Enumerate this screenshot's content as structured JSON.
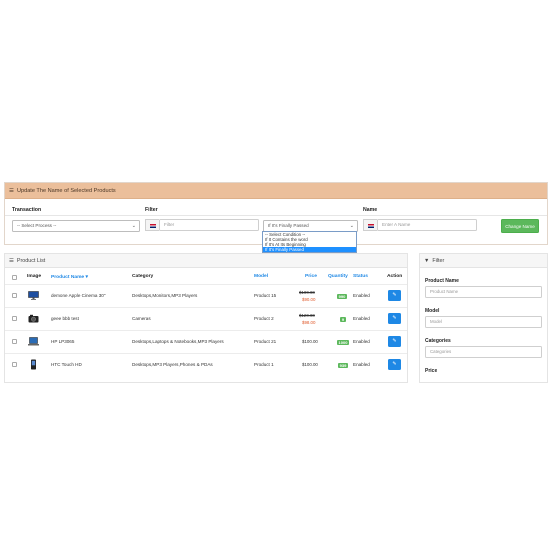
{
  "update_panel": {
    "title": "Update The Name of Selected Products",
    "transaction_label": "Transaction",
    "filter_label": "Filter",
    "name_label": "Name",
    "process_select_value": "-- Select Process --",
    "filter_placeholder": "Filter",
    "condition_select_value": "If It's Finally Passed",
    "condition_options": [
      "-- Select Condition --",
      "If It Contains the word",
      "If It's At Its Beginning",
      "If It's Finally Passed"
    ],
    "condition_selected_index": 3,
    "name_placeholder": "Enter A Name",
    "change_button_label": "Change Name"
  },
  "product_list": {
    "title": "Product List",
    "columns": {
      "image": "Image",
      "product_name": "Product Name",
      "category": "Category",
      "model": "Model",
      "price": "Price",
      "quantity": "Quantity",
      "status": "Status",
      "action": "Action"
    },
    "sort_icon": "caret-down-icon",
    "rows": [
      {
        "image": "monitor-icon",
        "name": "demone Apple Cinema 30\"",
        "category": "Desktops,Monitors,MP3 Players",
        "model": "Product 15",
        "price_old": "$100.00",
        "price_new": "$90.00",
        "quantity": "990",
        "status": "Enabled"
      },
      {
        "image": "camera-icon",
        "name": "geee bbb test",
        "category": "Cameras",
        "model": "Product 2",
        "price_old": "$120.00",
        "price_new": "$98.00",
        "quantity": "9",
        "status": "Enabled"
      },
      {
        "image": "laptop-icon",
        "name": "HP LP3065",
        "category": "Desktops,Laptops & Notebooks,MP3 Players",
        "model": "Product 21",
        "price_old": "",
        "price_new": "",
        "price": "$100.00",
        "quantity": "1000",
        "status": "Enabled"
      },
      {
        "image": "phone-icon",
        "name": "HTC Touch HD",
        "category": "Desktops,MP3 Players,Phones & PDAs",
        "model": "Product 1",
        "price_old": "",
        "price_new": "",
        "price": "$100.00",
        "quantity": "939",
        "status": "Enabled"
      }
    ]
  },
  "filter_panel": {
    "title": "Filter",
    "product_name_label": "Product Name",
    "product_name_placeholder": "Product Name",
    "model_label": "Model",
    "model_placeholder": "Model",
    "categories_label": "Categories",
    "categories_placeholder": "Categories",
    "price_label": "Price"
  },
  "colors": {
    "heading_accent": "#ebbf9b",
    "primary": "#1e88e5",
    "success": "#5cb85c",
    "discount": "#e05a2c"
  }
}
